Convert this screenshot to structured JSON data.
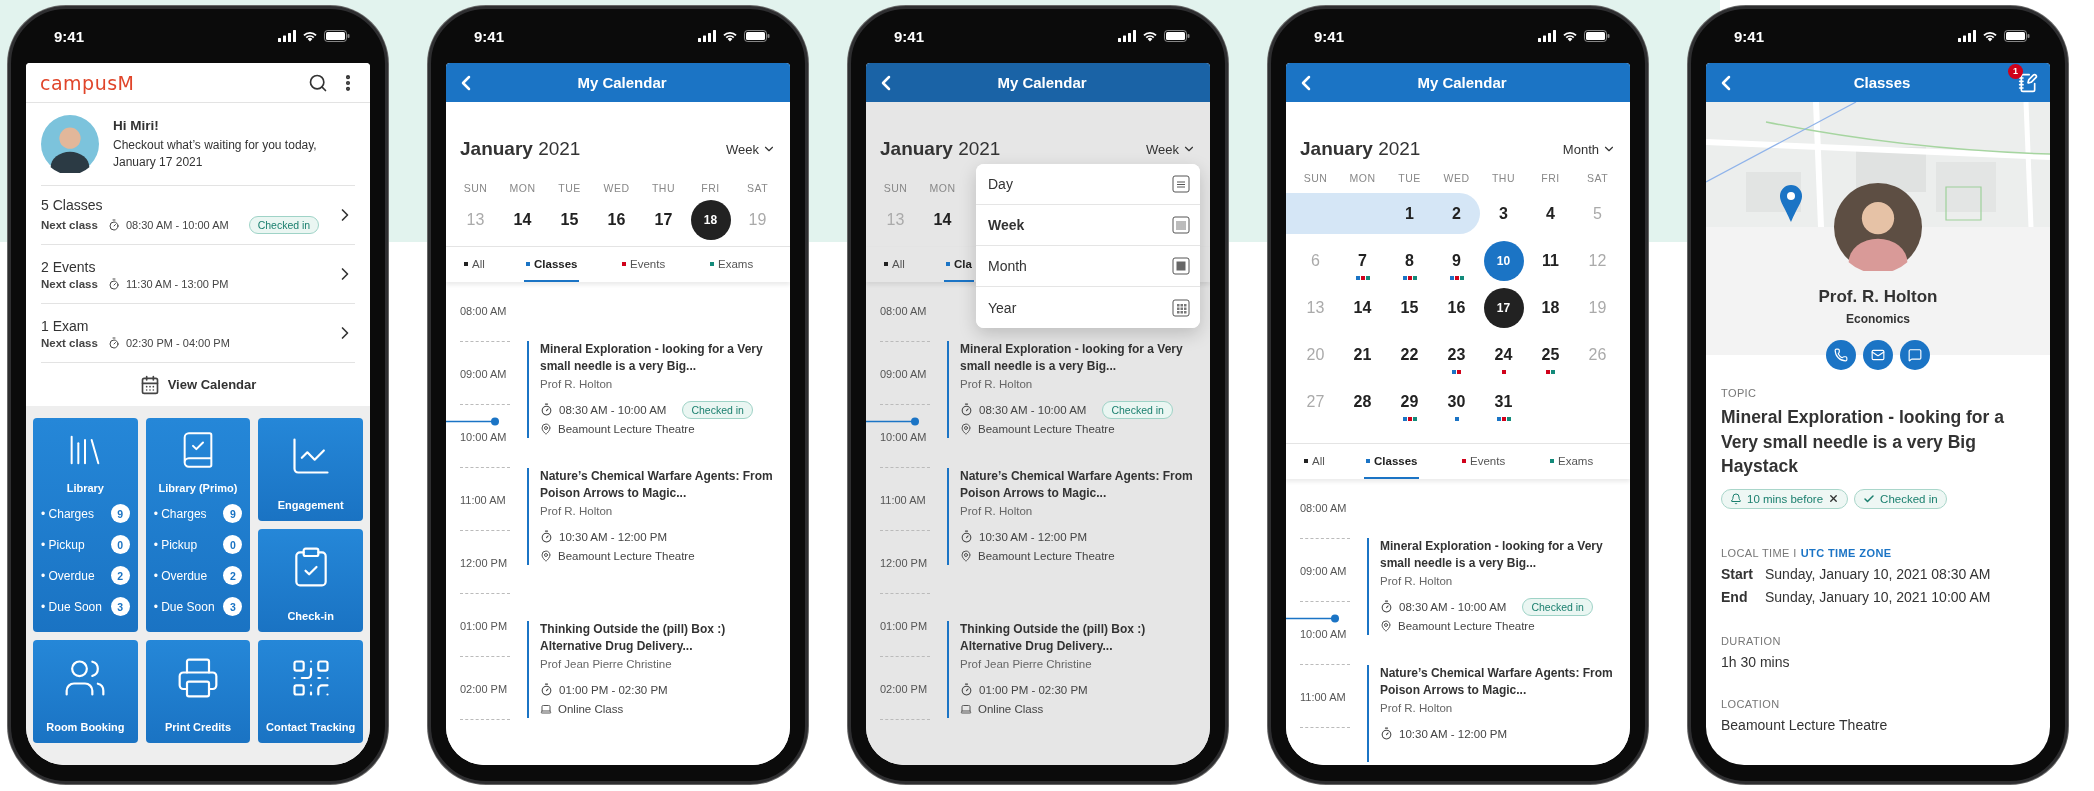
{
  "home": {
    "status_time": "9:41",
    "logo": "campusM",
    "greeting": "Hi Miri!",
    "message": "Checkout what’s waiting for you today, January 17 2021",
    "summaries": [
      {
        "title": "5 Classes",
        "label": "Next class",
        "time": "08:30 AM - 10:00 AM",
        "badge": "Checked in"
      },
      {
        "title": "2 Events",
        "label": "Next class",
        "time": "11:30 AM - 13:00 PM"
      },
      {
        "title": "1 Exam",
        "label": "Next class",
        "time": "02:30 PM - 04:00 PM"
      }
    ],
    "view_calendar": "View Calendar",
    "tiles": [
      {
        "kind": "stats",
        "label": "Library",
        "stats": [
          {
            "label": "• Charges",
            "count": "9"
          },
          {
            "label": "• Pickup",
            "count": "0"
          },
          {
            "label": "• Overdue",
            "count": "2"
          },
          {
            "label": "• Due Soon",
            "count": "3"
          }
        ]
      },
      {
        "kind": "stats",
        "label": "Library (Primo)",
        "stats": [
          {
            "label": "• Charges",
            "count": "9"
          },
          {
            "label": "• Pickup",
            "count": "0"
          },
          {
            "label": "• Overdue",
            "count": "2"
          },
          {
            "label": "• Due Soon",
            "count": "3"
          }
        ]
      },
      {
        "kind": "simple",
        "label": "Engagement"
      },
      {
        "kind": "simple",
        "label": "Check-in"
      },
      {
        "kind": "simple",
        "label": "Room Booking"
      },
      {
        "kind": "simple",
        "label": "Print Credits"
      },
      {
        "kind": "simple",
        "label": "Contact Tracking"
      }
    ]
  },
  "week_calendar": {
    "status_time": "9:41",
    "title": "My Calendar",
    "month_title": "**January** 2021",
    "view": "Week",
    "kind": "week",
    "days": [
      {
        "weekday": "SUN",
        "date": "13",
        "kind": "weekend",
        "selected": false
      },
      {
        "weekday": "MON",
        "date": "14",
        "kind": "weekday",
        "selected": false
      },
      {
        "weekday": "TUE",
        "date": "15",
        "kind": "weekday",
        "selected": false
      },
      {
        "weekday": "WED",
        "date": "16",
        "kind": "weekday",
        "selected": false
      },
      {
        "weekday": "THU",
        "date": "17",
        "kind": "weekday",
        "selected": false
      },
      {
        "weekday": "FRI",
        "date": "18",
        "kind": "weekday",
        "selected": true
      },
      {
        "weekday": "SAT",
        "date": "19",
        "kind": "weekend",
        "selected": false
      }
    ],
    "filters": [
      {
        "label": "All",
        "color": "#222222",
        "selected": false
      },
      {
        "label": "Classes",
        "color": "#1b74c5",
        "selected": true
      },
      {
        "label": "Events",
        "color": "#d0021b",
        "selected": false
      },
      {
        "label": "Exams",
        "color": "#138a7a",
        "selected": false
      }
    ],
    "times": [
      "08:00 AM",
      "09:00 AM",
      "10:00 AM",
      "11:00 AM",
      "12:00 PM",
      "01:00 PM",
      "02:00 PM"
    ],
    "events": [
      {
        "title": "Mineral Exploration - looking for a Very small needle is a very Big...",
        "person": "Prof R. Holton",
        "time": "08:30 AM - 10:00 AM",
        "badge": "Checked in",
        "kind": "venue",
        "place": "Beamount Lecture Theatre"
      },
      {
        "title": "Nature’s Chemical Warfare Agents: From Poison Arrows to Magic...",
        "person": "Prof R. Holton",
        "time": "10:30 AM - 12:00 PM",
        "kind": "venue",
        "place": "Beamount Lecture Theatre"
      },
      {
        "title": "Thinking Outside the (pill) Box :) Alternative Drug Delivery...",
        "person": "Prof Jean Pierre Christine",
        "time": "01:00 PM - 02:30 PM",
        "kind": "online",
        "place": "Online Class"
      }
    ]
  },
  "week_calendar_menu": {
    "status_time": "9:41",
    "title": "My Calendar",
    "month_title": "**January** 2021",
    "view": "Week",
    "kind": "week",
    "days": [
      {
        "weekday": "SUN",
        "date": "13",
        "kind": "weekend",
        "selected": false
      },
      {
        "weekday": "MON",
        "date": "14",
        "kind": "weekday",
        "selected": false
      }
    ],
    "filters": [
      {
        "label": "All",
        "color": "#222222",
        "selected": false
      },
      {
        "label": "Cla",
        "color": "#1b74c5",
        "selected": true
      }
    ],
    "times": [
      "08:00 AM",
      "09:00 AM",
      "10:00 AM",
      "11:00 AM",
      "12:00 PM",
      "01:00 PM",
      "02:00 PM"
    ],
    "events": [
      {
        "title": "Mineral Exploration - looking for a Very small needle is a very Big...",
        "person": "Prof R. Holton",
        "time": "08:30 AM - 10:00 AM",
        "badge": "Checked in",
        "kind": "venue",
        "place": "Beamount Lecture Theatre"
      },
      {
        "title": "Nature’s Chemical Warfare Agents: From Poison Arrows to Magic...",
        "person": "Prof R. Holton",
        "time": "10:30 AM - 12:00 PM",
        "kind": "venue",
        "place": "Beamount Lecture Theatre"
      },
      {
        "title": "Thinking Outside the (pill) Box :) Alternative Drug Delivery...",
        "person": "Prof Jean Pierre Christine",
        "time": "01:00 PM - 02:30 PM",
        "kind": "online",
        "place": "Online Class"
      }
    ],
    "view_menu": [
      {
        "label": "Day",
        "selected": false
      },
      {
        "label": "Week",
        "selected": true
      },
      {
        "label": "Month",
        "selected": false
      },
      {
        "label": "Year",
        "selected": false
      }
    ]
  },
  "month_calendar": {
    "status_time": "9:41",
    "title": "My Calendar",
    "month_title": "**January** 2021",
    "view": "Month",
    "kind": "month",
    "weekdays": [
      "SUN",
      "MON",
      "TUE",
      "WED",
      "THU",
      "FRI",
      "SAT"
    ],
    "days": [
      {
        "kind": "blank",
        "in_range": true
      },
      {
        "kind": "blank",
        "in_range": true
      },
      {
        "kind": "weekday",
        "date": "1",
        "selected": false,
        "in_range": true
      },
      {
        "kind": "weekday",
        "date": "2",
        "selected": false,
        "in_range": true
      },
      {
        "kind": "weekday",
        "date": "3",
        "selected": false,
        "in_range": false
      },
      {
        "kind": "weekday",
        "date": "4",
        "selected": false,
        "in_range": false
      },
      {
        "kind": "weekend",
        "date": "5",
        "selected": false,
        "in_range": false
      },
      {
        "kind": "weekend",
        "date": "6",
        "selected": false,
        "in_range": false
      },
      {
        "kind": "weekday",
        "date": "7",
        "selected": false,
        "in_range": false,
        "dots": [
          {
            "color": "#1b74c5"
          },
          {
            "color": "#d0021b"
          },
          {
            "color": "#138a7a"
          }
        ]
      },
      {
        "kind": "weekday",
        "date": "8",
        "selected": false,
        "in_range": false,
        "dots": [
          {
            "color": "#1b74c5"
          },
          {
            "color": "#d0021b"
          },
          {
            "color": "#138a7a"
          }
        ]
      },
      {
        "kind": "weekday",
        "date": "9",
        "selected": false,
        "in_range": false,
        "dots": [
          {
            "color": "#1b74c5"
          },
          {
            "color": "#d0021b"
          },
          {
            "color": "#138a7a"
          }
        ]
      },
      {
        "kind": "weekday",
        "date": "10",
        "selected": true,
        "in_range": false
      },
      {
        "kind": "weekday",
        "date": "11",
        "selected": false,
        "in_range": false
      },
      {
        "kind": "weekend",
        "date": "12",
        "selected": false,
        "in_range": false
      },
      {
        "kind": "weekend",
        "date": "13",
        "selected": false,
        "in_range": false
      },
      {
        "kind": "weekday",
        "date": "14",
        "selected": false,
        "in_range": false
      },
      {
        "kind": "weekday",
        "date": "15",
        "selected": false,
        "in_range": false
      },
      {
        "kind": "weekday",
        "date": "16",
        "selected": false,
        "in_range": false
      },
      {
        "kind": "today",
        "date": "17",
        "selected": false,
        "in_range": false
      },
      {
        "kind": "weekday",
        "date": "18",
        "selected": false,
        "in_range": false
      },
      {
        "kind": "weekend",
        "date": "19",
        "selected": false,
        "in_range": false
      },
      {
        "kind": "weekend",
        "date": "20",
        "selected": false,
        "in_range": false
      },
      {
        "kind": "weekday",
        "date": "21",
        "selected": false,
        "in_range": false
      },
      {
        "kind": "weekday",
        "date": "22",
        "selected": false,
        "in_range": false
      },
      {
        "kind": "weekday",
        "date": "23",
        "selected": false,
        "in_range": false,
        "dots": [
          {
            "color": "#1b74c5"
          },
          {
            "color": "#d0021b"
          }
        ]
      },
      {
        "kind": "weekday",
        "date": "24",
        "selected": false,
        "in_range": false,
        "dots": [
          {
            "color": "#d0021b"
          }
        ]
      },
      {
        "kind": "weekday",
        "date": "25",
        "selected": false,
        "in_range": false,
        "dots": [
          {
            "color": "#d0021b"
          },
          {
            "color": "#138a7a"
          }
        ]
      },
      {
        "kind": "weekend",
        "date": "26",
        "selected": false,
        "in_range": false
      },
      {
        "kind": "weekend",
        "date": "27",
        "selected": false,
        "in_range": false
      },
      {
        "kind": "weekday",
        "date": "28",
        "selected": false,
        "in_range": false
      },
      {
        "kind": "weekday",
        "date": "29",
        "selected": false,
        "in_range": false,
        "dots": [
          {
            "color": "#1b74c5"
          },
          {
            "color": "#d0021b"
          },
          {
            "color": "#138a7a"
          }
        ]
      },
      {
        "kind": "weekday",
        "date": "30",
        "selected": false,
        "in_range": false,
        "dots": [
          {
            "color": "#1b74c5"
          }
        ]
      },
      {
        "kind": "weekday",
        "date": "31",
        "selected": false,
        "in_range": false,
        "dots": [
          {
            "color": "#1b74c5"
          },
          {
            "color": "#d0021b"
          },
          {
            "color": "#138a7a"
          }
        ]
      }
    ],
    "filters": [
      {
        "label": "All",
        "color": "#222222",
        "selected": false
      },
      {
        "label": "Classes",
        "color": "#1b74c5",
        "selected": true
      },
      {
        "label": "Events",
        "color": "#d0021b",
        "selected": false
      },
      {
        "label": "Exams",
        "color": "#138a7a",
        "selected": false
      }
    ],
    "times": [
      "08:00 AM",
      "09:00 AM",
      "10:00 AM",
      "11:00 AM"
    ],
    "events": [
      {
        "title": "Mineral Exploration - looking for a Very small needle is a very Big...",
        "person": "Prof R. Holton",
        "time": "08:30 AM - 10:00 AM",
        "badge": "Checked in",
        "kind": "venue",
        "place": "Beamount Lecture Theatre"
      },
      {
        "title": "Nature’s Chemical Warfare Agents: From Poison Arrows to Magic...",
        "person": "Prof R. Holton",
        "time": "10:30 AM - 12:00 PM"
      }
    ]
  },
  "class_detail": {
    "status_time": "9:41",
    "title": "Classes",
    "notification_count": "1",
    "name": "Prof. R. Holton",
    "department": "Economics",
    "topic_label": "TOPIC",
    "topic": "Mineral Exploration - looking for a Very small needle is a very Big Haystack",
    "reminder": "10 mins before",
    "status": "Checked in",
    "time_label": "LOCAL TIME I",
    "time_zone_link": "UTC TIME ZONE",
    "schedule": [
      {
        "label": "Start",
        "value": "Sunday, January 10, 2021 08:30 AM"
      },
      {
        "label": "End",
        "value": "Sunday, January 10, 2021 10:00 AM"
      }
    ],
    "duration_label": "DURATION",
    "duration": "1h 30 mins",
    "location_label": "LOCATION",
    "location": "Beamount Lecture Theatre"
  }
}
